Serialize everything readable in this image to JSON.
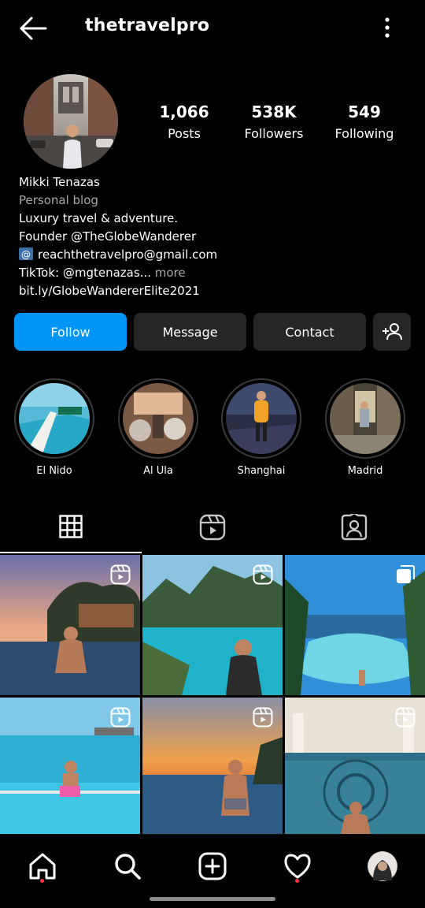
{
  "header": {
    "username": "thetravelpro"
  },
  "stats": {
    "posts": {
      "value": "1,066",
      "label": "Posts"
    },
    "followers": {
      "value": "538K",
      "label": "Followers"
    },
    "following": {
      "value": "549",
      "label": "Following"
    }
  },
  "bio": {
    "name": "Mikki Tenazas",
    "category": "Personal blog",
    "line1": "Luxury travel & adventure.",
    "line2": "Founder @TheGlobeWanderer",
    "email": "reachthetravelpro@gmail.com",
    "tiktok": "TikTok: @mgtenazas...",
    "more": "more",
    "link": "bit.ly/GlobeWandererElite2021"
  },
  "buttons": {
    "follow": "Follow",
    "message": "Message",
    "contact": "Contact"
  },
  "highlights": [
    {
      "label": "El Nido"
    },
    {
      "label": "Al Ula"
    },
    {
      "label": "Shanghai"
    },
    {
      "label": "Madrid"
    }
  ],
  "colors": {
    "background": "#000000",
    "follow_blue": "#0095f6",
    "secondary_button": "#262626",
    "muted_text": "#a8a8a8",
    "notification_red": "#ff3040"
  },
  "icons": {
    "back": "arrow-left-icon",
    "more": "more-vertical-icon",
    "add_user": "add-person-icon",
    "grid": "grid-icon",
    "reels": "reels-icon",
    "tagged": "tagged-icon",
    "reel_badge": "reel-icon",
    "carousel_badge": "carousel-icon",
    "home": "home-icon",
    "search": "search-icon",
    "create": "plus-square-icon",
    "activity": "heart-icon",
    "profile": "profile-avatar"
  }
}
